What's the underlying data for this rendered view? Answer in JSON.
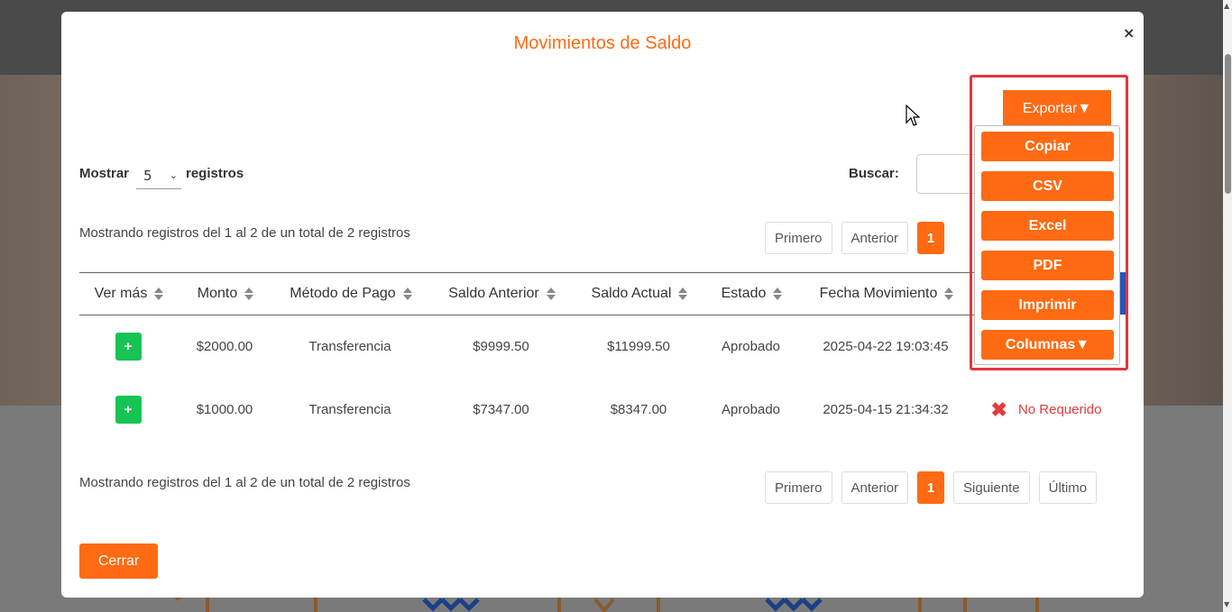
{
  "modal": {
    "title": "Movimientos de Saldo",
    "close_label": "×",
    "length": {
      "label_before": "Mostrar",
      "value": "5",
      "label_after": "registros"
    },
    "search": {
      "label": "Buscar:",
      "value": ""
    },
    "info": "Mostrando registros del 1 al 2 de un total de 2 registros",
    "pagination_top": [
      "Primero",
      "Anterior",
      "1"
    ],
    "pagination_bottom": [
      "Primero",
      "Anterior",
      "1",
      "Siguiente",
      "Último"
    ],
    "table": {
      "columns": [
        "Ver más",
        "Monto",
        "Método de Pago",
        "Saldo Anterior",
        "Saldo Actual",
        "Estado",
        "Fecha Movimiento"
      ],
      "rows": [
        {
          "ver_mas": "+",
          "monto": "$2000.00",
          "metodo": "Transferencia",
          "saldo_anterior": "$9999.50",
          "saldo_actual": "$11999.50",
          "estado": "Aprobado",
          "fecha": "2025-04-22 19:03:45",
          "extra": ""
        },
        {
          "ver_mas": "+",
          "monto": "$1000.00",
          "metodo": "Transferencia",
          "saldo_anterior": "$7347.00",
          "saldo_actual": "$8347.00",
          "estado": "Aprobado",
          "fecha": "2025-04-15 21:34:32",
          "extra": "No Requerido"
        }
      ]
    },
    "close_button": "Cerrar"
  },
  "export": {
    "button": "Exportar▼",
    "items": [
      "Copiar",
      "CSV",
      "Excel",
      "PDF",
      "Imprimir",
      "Columnas▼"
    ]
  },
  "colors": {
    "accent": "#ff6a13",
    "success": "#16c454",
    "danger": "#e23b3b",
    "highlight_outline": "#e0363f"
  }
}
